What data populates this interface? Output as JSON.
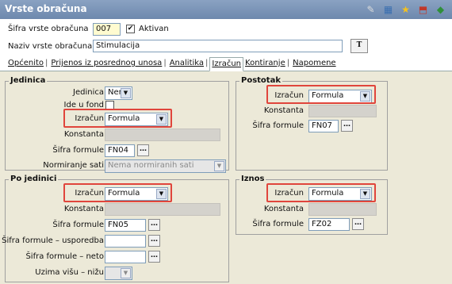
{
  "window": {
    "title": "Vrste obračuna"
  },
  "header": {
    "sifra_label": "Šifra vrste obračuna",
    "sifra_value": "007",
    "aktivan_label": "Aktivan",
    "aktivan_checked": true,
    "naziv_label": "Naziv vrste obračuna",
    "naziv_value": "Stimulacija",
    "translate_label": "T"
  },
  "tabs": [
    {
      "label": "Općenito"
    },
    {
      "label": "Prijenos iz posrednog unosa"
    },
    {
      "label": "Analitika"
    },
    {
      "label": "Izračun",
      "active": true
    },
    {
      "label": "Kontiranje"
    },
    {
      "label": "Napomene"
    }
  ],
  "jedinica": {
    "title": "Jedinica",
    "jedinica_label": "Jedinica",
    "jedinica_value": "Nema j",
    "ide_u_fond_label": "Ide u fond",
    "izracun_label": "Izračun",
    "izracun_value": "Formula",
    "konstanta_label": "Konstanta",
    "sifra_formule_label": "Šifra formule",
    "sifra_formule_value": "FN04",
    "normiranje_label": "Normiranje sati",
    "normiranje_value": "Nema normiranih sati"
  },
  "postotak": {
    "title": "Postotak",
    "izracun_label": "Izračun",
    "izracun_value": "Formula",
    "konstanta_label": "Konstanta",
    "sifra_formule_label": "Šifra formule",
    "sifra_formule_value": "FN07"
  },
  "po_jedinici": {
    "title": "Po jedinici",
    "izracun_label": "Izračun",
    "izracun_value": "Formula",
    "konstanta_label": "Konstanta",
    "sifra_formule_label": "Šifra formule",
    "sifra_formule_value": "FN05",
    "usporedba_label": "Šifra formule – usporedba",
    "neto_label": "Šifra formule – neto",
    "uzima_label": "Uzima višu – nižu"
  },
  "iznos": {
    "title": "Iznos",
    "izracun_label": "Izračun",
    "izracun_value": "Formula",
    "konstanta_label": "Konstanta",
    "sifra_formule_label": "Šifra formule",
    "sifra_formule_value": "FZ02"
  },
  "icons": [
    "edit-icon",
    "grid-icon",
    "star-icon",
    "export-icon",
    "exit-icon"
  ]
}
